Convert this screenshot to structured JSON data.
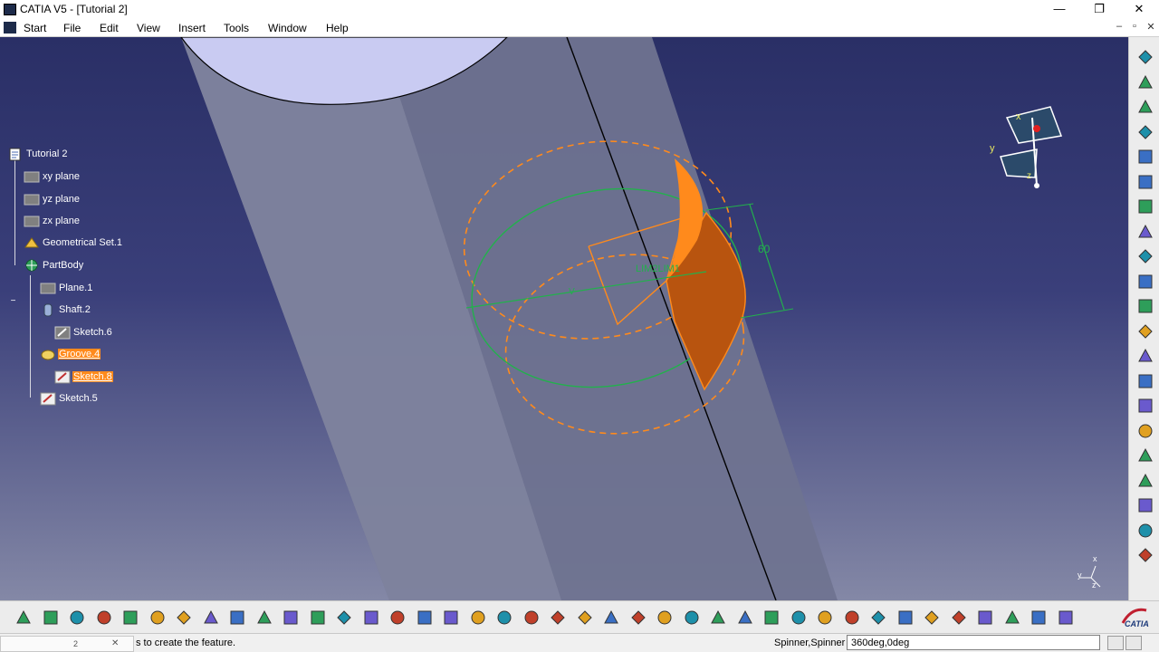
{
  "window": {
    "title": "CATIA V5 - [Tutorial 2]",
    "minimize": "—",
    "restore": "❐",
    "close": "✕"
  },
  "menu": {
    "items": [
      "Start",
      "File",
      "Edit",
      "View",
      "Insert",
      "Tools",
      "Window",
      "Help"
    ],
    "doc_minimize": "–",
    "doc_restore": "▫",
    "doc_close": "✕"
  },
  "tree": {
    "nodes": [
      {
        "label": "Tutorial 2",
        "icon": "part-icon"
      },
      {
        "label": "xy plane",
        "icon": "plane-icon"
      },
      {
        "label": "yz plane",
        "icon": "plane-icon"
      },
      {
        "label": "zx plane",
        "icon": "plane-icon"
      },
      {
        "label": "Geometrical Set.1",
        "icon": "geometrical-set-icon"
      },
      {
        "label": "PartBody",
        "icon": "body-icon"
      },
      {
        "label": "Plane.1",
        "icon": "plane-icon"
      },
      {
        "label": "Shaft.2",
        "icon": "shaft-icon"
      },
      {
        "label": "Sketch.6",
        "icon": "sketch-icon"
      },
      {
        "label": "Groove.4",
        "icon": "groove-icon",
        "selected": true
      },
      {
        "label": "Sketch.8",
        "icon": "sketch-icon",
        "selected": true
      },
      {
        "label": "Sketch.5",
        "icon": "sketch-icon"
      }
    ]
  },
  "viewport": {
    "annotations": {
      "dimension": "60",
      "limits": "LIM2LIM1",
      "axis_v": "V",
      "compass_x": "x",
      "compass_y": "y",
      "compass_z": "z",
      "triad_x": "x",
      "triad_y": "y",
      "triad_z": "z"
    },
    "colors": {
      "background_top": "#2a2f66",
      "background_bottom": "#8488a6",
      "shaft": "#6f7390",
      "shaft_top": "#c9cbf2",
      "preview_orange": "#ff8a1c",
      "sketch_green": "#22b14c"
    }
  },
  "right_toolbar": {
    "icons": [
      "gear-icon",
      "select-arrow-icon",
      "sketch-icon",
      "pad-icon",
      "pocket-icon",
      "shaft-icon",
      "groove-icon",
      "hole-icon",
      "rib-icon",
      "slot-icon",
      "stiffener-icon",
      "multi-section-solid-icon",
      "removed-multi-section-icon",
      "edge-fillet-icon",
      "chamfer-icon",
      "draft-icon",
      "shell-icon",
      "thickness-icon",
      "thread-icon",
      "translation-icon",
      "mirror-icon"
    ]
  },
  "bottom_toolbar": {
    "icons": [
      "new-icon",
      "open-icon",
      "save-icon",
      "print-icon",
      "cut-icon",
      "copy-icon",
      "paste-icon",
      "undo-icon",
      "redo-icon",
      "whats-this-icon",
      "formula-icon",
      "knowledge-icon",
      "spec-icon",
      "table-icon",
      "catalog-icon",
      "measure-icon",
      "apply-material-icon",
      "fly-mode-icon",
      "fit-all-icon",
      "pan-icon",
      "rotate-icon",
      "zoom-in-icon",
      "zoom-out-icon",
      "normal-view-icon",
      "multi-view-icon",
      "iso-view-icon",
      "hide-show-icon",
      "swap-space-icon",
      "render-style-icon",
      "update-icon",
      "constraint-icon",
      "anchor-icon",
      "lock-icon",
      "capture-icon",
      "axis-system-icon",
      "reorder-icon",
      "manipulator-icon",
      "point-icon",
      "dimension-icon",
      "shading-icon"
    ]
  },
  "status": {
    "message": "s to create the feature.",
    "panel_value": "2",
    "command_label": "Spinner,Spinner",
    "command_value": "360deg,0deg",
    "catia_logo": "CATIA"
  }
}
